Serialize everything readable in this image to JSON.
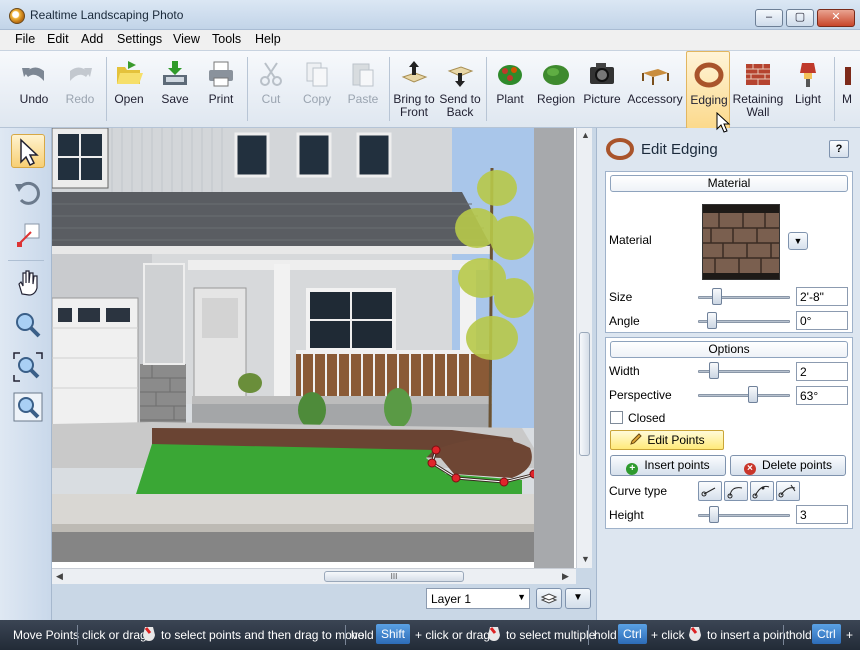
{
  "window": {
    "title": "Realtime Landscaping Photo",
    "min": "–",
    "max": "▢",
    "close": "✕"
  },
  "menu": [
    "File",
    "Edit",
    "Add",
    "Settings",
    "View",
    "Tools",
    "Help"
  ],
  "toolbar": {
    "undo": "Undo",
    "redo": "Redo",
    "open": "Open",
    "save": "Save",
    "print": "Print",
    "cut": "Cut",
    "copy": "Copy",
    "paste": "Paste",
    "bring_front_1": "Bring to",
    "bring_front_2": "Front",
    "send_back_1": "Send to",
    "send_back_2": "Back",
    "plant": "Plant",
    "region": "Region",
    "picture": "Picture",
    "accessory": "Accessory",
    "edging": "Edging",
    "retaining_1": "Retaining",
    "retaining_2": "Wall",
    "light": "Light",
    "more": "M"
  },
  "canvas": {
    "hthumb_grip": "III",
    "layer": "Layer 1"
  },
  "panel": {
    "title": "Edit Edging",
    "help": "?",
    "material_group": "Material",
    "material_label": "Material",
    "size_label": "Size",
    "size_value": "2'-8\"",
    "angle_label": "Angle",
    "angle_value": "0°",
    "options_group": "Options",
    "width_label": "Width",
    "width_value": "2",
    "perspective_label": "Perspective",
    "perspective_value": "63°",
    "closed_label": "Closed",
    "edit_points": "Edit Points",
    "insert_points": "Insert points",
    "delete_points": "Delete points",
    "curve_type_label": "Curve type",
    "height_label": "Height",
    "height_value": "3"
  },
  "status": {
    "mode": "Move Points",
    "part1": "click or drag",
    "part2": "to select points and then drag to move",
    "hold1": "hold",
    "key_shift": "Shift",
    "part3": "+ click or drag",
    "part4": "to select multiple",
    "hold2": "hold",
    "key_ctrl1": "Ctrl",
    "part5": "+ click",
    "part6": "to insert a point",
    "hold3": "hold",
    "key_ctrl2": "Ctrl",
    "part7": "+"
  },
  "colors": {
    "accent": "#2d6cb8",
    "status_bg": "#2a3340",
    "edit_points_bg": "#ffea7a",
    "grass": "#3aa735"
  }
}
